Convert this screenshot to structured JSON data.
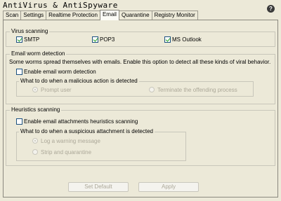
{
  "app": {
    "title": "AntiVirus & AntiSpyware",
    "help_icon": "?"
  },
  "tabs": [
    {
      "label": "Scan",
      "active": false
    },
    {
      "label": "Settings",
      "active": false
    },
    {
      "label": "Realtime Protection",
      "active": false
    },
    {
      "label": "Email",
      "active": true
    },
    {
      "label": "Quarantine",
      "active": false
    },
    {
      "label": "Registry Monitor",
      "active": false
    }
  ],
  "virus_scanning": {
    "legend": "Virus scanning",
    "smtp": {
      "label": "SMTP",
      "checked": true
    },
    "pop3": {
      "label": "POP3",
      "checked": true
    },
    "ms_outlook": {
      "label": "MS Outlook",
      "checked": true
    }
  },
  "worm_detection": {
    "legend": "Email worm detection",
    "description": "Some worms spread themselves with emails. Enable this option to detect all these kinds of viral behavior.",
    "enable": {
      "label": "Enable email worm detection",
      "checked": false
    },
    "action_legend": "What to do when a malicious action is detected",
    "prompt_user": {
      "label": "Prompt user",
      "selected": true
    },
    "terminate": {
      "label": "Terminate the offending process",
      "selected": false
    }
  },
  "heuristics": {
    "legend": "Heuristics scanning",
    "enable": {
      "label": "Enable email attachments heuristics scanning",
      "checked": false
    },
    "action_legend": "What to do when a suspicious attachment is detected",
    "log_warning": {
      "label": "Log a warning message",
      "selected": true
    },
    "strip_quarantine": {
      "label": "Strip and quarantine",
      "selected": false
    }
  },
  "buttons": {
    "set_default": "Set Default",
    "apply": "Apply"
  },
  "colors": {
    "background": "#ece9d8",
    "checkmark": "#21a121",
    "disabled_text": "#aca899"
  }
}
